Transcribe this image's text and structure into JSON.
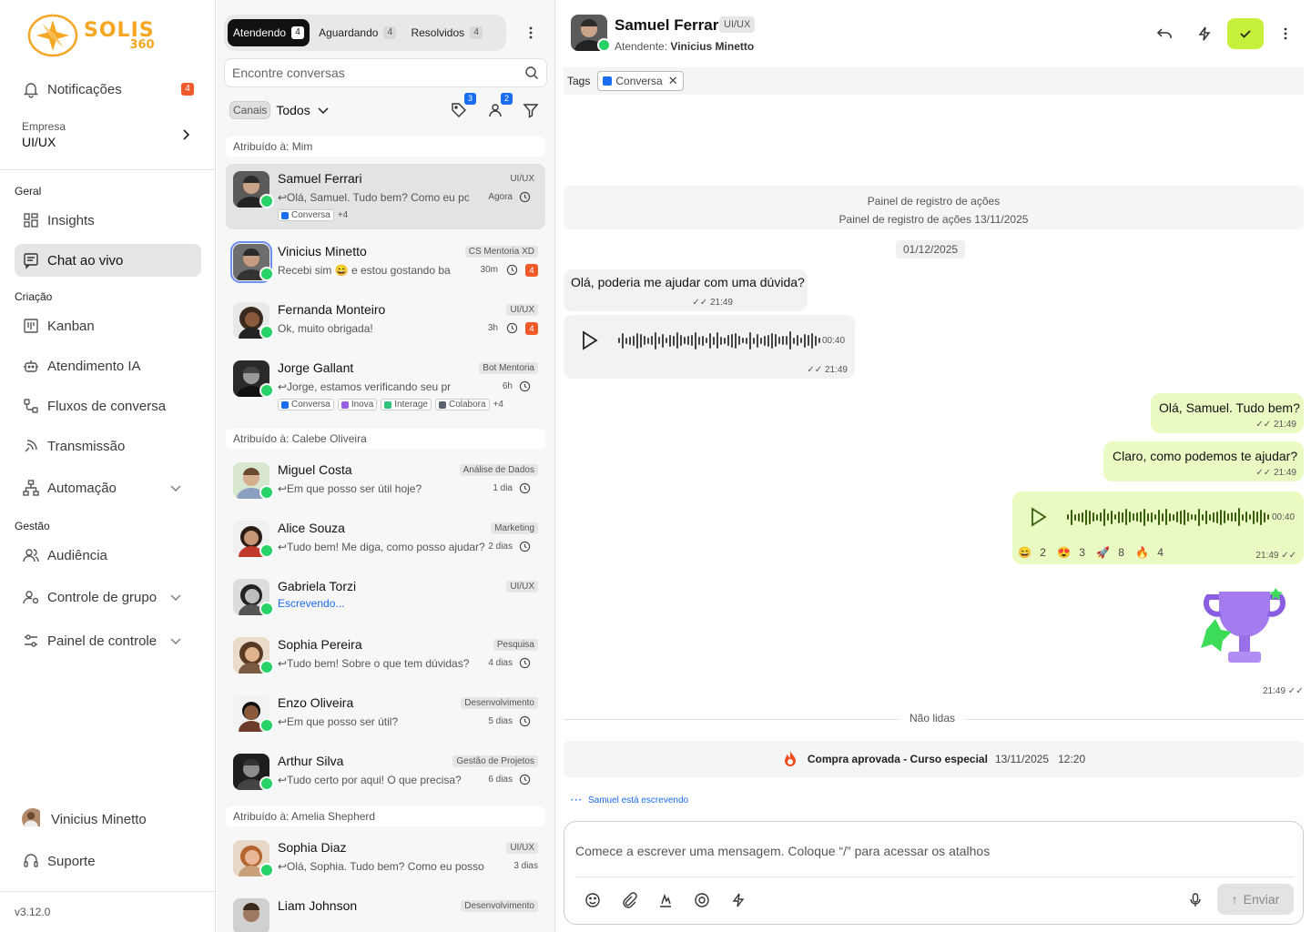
{
  "brand": {
    "name": "SOLIS",
    "sub": "360",
    "color": "#f5a623"
  },
  "sidebar": {
    "notifications": {
      "label": "Notificações",
      "count": "4"
    },
    "company": {
      "label": "Empresa",
      "value": "UI/UX"
    },
    "sections": {
      "geral": "Geral",
      "criacao": "Criação",
      "gestao": "Gestão"
    },
    "items": [
      {
        "label": "Insights",
        "icon": "grid-icon"
      },
      {
        "label": "Chat ao vivo",
        "icon": "chat-icon",
        "active": true
      },
      {
        "label": "Kanban",
        "icon": "kanban-icon"
      },
      {
        "label": "Atendimento IA",
        "icon": "robot-icon"
      },
      {
        "label": "Fluxos de conversa",
        "icon": "flow-icon"
      },
      {
        "label": "Transmissão",
        "icon": "broadcast-icon"
      },
      {
        "label": "Automação",
        "icon": "sitemap-icon"
      },
      {
        "label": "Audiência",
        "icon": "users-icon"
      },
      {
        "label": "Controle de grupo",
        "icon": "user-gear-icon"
      },
      {
        "label": "Painel de controle",
        "icon": "sliders-icon"
      }
    ],
    "user": "Vinicius Minetto",
    "support": "Suporte",
    "version": "v3.12.0"
  },
  "list": {
    "tabs": [
      {
        "label": "Atendendo",
        "count": "4"
      },
      {
        "label": "Aguardando",
        "count": "4"
      },
      {
        "label": "Resolvidos",
        "count": "4"
      }
    ],
    "search_placeholder": "Encontre conversas",
    "filter": {
      "channels": "Canais",
      "value": "Todos",
      "tag_count": "3",
      "user_count": "2"
    },
    "groups": [
      "Atribuído à: Mim",
      "Atribuído à: Calebe Oliveira",
      "Atribuído à: Amelia Shepherd"
    ],
    "conversations": [
      {
        "name": "Samuel Ferrari",
        "team": "UI/UX",
        "msg": "↩Olá, Samuel. Tudo bem? Como eu poss...",
        "time": "Agora",
        "chips": [
          "Conversa"
        ],
        "more": "+4"
      },
      {
        "name": "Vinicius Minetto",
        "team": "CS Mentoria XD",
        "msg": "Recebi sim 😄 e estou gostando bastant...",
        "time": "30m",
        "unread": "4"
      },
      {
        "name": "Fernanda Monteiro",
        "team": "UI/UX",
        "msg": "Ok, muito obrigada!",
        "time": "3h",
        "unread": "4"
      },
      {
        "name": "Jorge Gallant",
        "team": "Bot Mentoria",
        "msg": "↩Jorge, estamos verificando seu problema...",
        "time": "6h",
        "chips": [
          "Conversa",
          "Inova",
          "Interage",
          "Colabora"
        ],
        "more": "+4"
      },
      {
        "name": "Miguel Costa",
        "team": "Análise de Dados",
        "msg": "↩Em que posso ser útil hoje?",
        "time": "1 dia"
      },
      {
        "name": "Alice Souza",
        "team": "Marketing",
        "msg": "↩Tudo bem! Me diga, como posso ajudar?",
        "time": "2 dias"
      },
      {
        "name": "Gabriela Torzi",
        "team": "UI/UX",
        "typing": "Escrevendo..."
      },
      {
        "name": "Sophia Pereira",
        "team": "Pesquisa",
        "msg": "↩Tudo bem! Sobre o que tem dúvidas?",
        "time": "4 dias"
      },
      {
        "name": "Enzo Oliveira",
        "team": "Desenvolvimento",
        "msg": "↩Em que posso ser útil?",
        "time": "5 dias"
      },
      {
        "name": "Arthur Silva",
        "team": "Gestão de Projetos",
        "msg": "↩Tudo certo por aqui! O que precisa?",
        "time": "6 dias"
      },
      {
        "name": "Sophia Diaz",
        "team": "UI/UX",
        "msg": "↩Olá, Sophia. Tudo bem? Como eu posso te aj...",
        "time": "3 dias"
      },
      {
        "name": "Liam Johnson",
        "team": "Desenvolvimento"
      }
    ]
  },
  "chat": {
    "contact": "Samuel Ferrari",
    "team": "UI/UX",
    "attendant_label": "Atendente:",
    "attendant": "Vinicius Minetto",
    "tags_label": "Tags",
    "tag": "Conversa",
    "log_title": "Painel de registro de ações",
    "log_line": "Painel de registro de ações  13/11/2025",
    "date": "01/12/2025",
    "messages": [
      {
        "dir": "in",
        "text": "Olá, poderia me ajudar com uma dúvida?",
        "time": "21:49"
      },
      {
        "dir": "in",
        "audio": "00:40",
        "time": "21:49"
      },
      {
        "dir": "out",
        "text": "Olá, Samuel. Tudo bem?",
        "time": "21:49"
      },
      {
        "dir": "out",
        "text": "Claro, como podemos te ajudar?",
        "time": "21:49"
      },
      {
        "dir": "out",
        "audio": "00:40",
        "time": "21:49",
        "reactions": [
          {
            "e": "😄",
            "n": "2"
          },
          {
            "e": "😍",
            "n": "3"
          },
          {
            "e": "🚀",
            "n": "8"
          },
          {
            "e": "🔥",
            "n": "4"
          }
        ]
      },
      {
        "dir": "out",
        "sticker": "trophy",
        "time": "21:49"
      }
    ],
    "unread_label": "Não lidas",
    "event": {
      "title": "Compra aprovada - Curso especial",
      "date": "13/11/2025",
      "time": "12:20"
    },
    "writing": "Samuel está escrevendo",
    "composer_placeholder": "Comece a escrever uma mensagem. Coloque “/” para acessar os atalhos",
    "send_label": "Enviar",
    "accent": "#c6f03c"
  }
}
